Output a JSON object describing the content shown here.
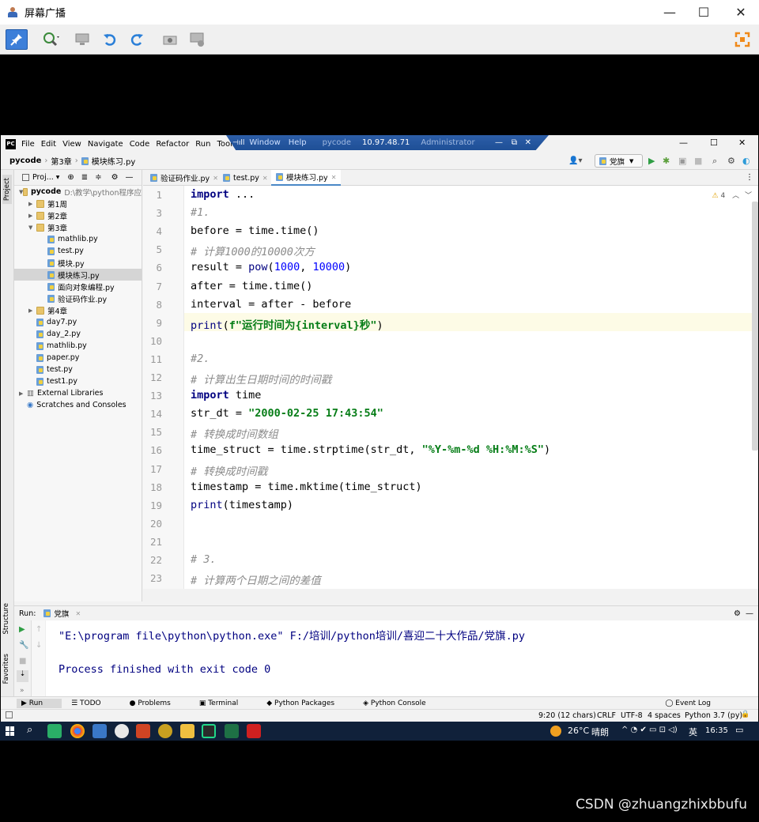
{
  "outer_window": {
    "title": "屏幕广播",
    "minimize": "—",
    "maximize": "☐",
    "close": "✕"
  },
  "ide": {
    "menu": [
      "File",
      "Edit",
      "View",
      "Navigate",
      "Code",
      "Refactor",
      "Run",
      "Tools"
    ],
    "remote_bar": {
      "items": [
        "Window",
        "Help"
      ],
      "host_label": "pycode",
      "ip": "10.97.48.71",
      "user": "Administrator"
    },
    "window_controls": {
      "minimize": "—",
      "maximize": "☐",
      "close": "✕"
    },
    "breadcrumb": [
      "pycode",
      "第3章",
      "模块练习.py"
    ],
    "run_config": "党旗",
    "project_panel": {
      "title": "Proj...",
      "root": {
        "name": "pycode",
        "path": "D:\\教学\\python程序应"
      },
      "items": [
        {
          "label": "第1周",
          "type": "folder",
          "level": 1,
          "expanded": false
        },
        {
          "label": "第2章",
          "type": "folder",
          "level": 1,
          "expanded": false
        },
        {
          "label": "第3章",
          "type": "folder",
          "level": 1,
          "expanded": true
        },
        {
          "label": "mathlib.py",
          "type": "py",
          "level": 2
        },
        {
          "label": "test.py",
          "type": "py",
          "level": 2
        },
        {
          "label": "模块.py",
          "type": "py",
          "level": 2
        },
        {
          "label": "模块练习.py",
          "type": "py",
          "level": 2,
          "selected": true
        },
        {
          "label": "面向对象编程.py",
          "type": "py",
          "level": 2
        },
        {
          "label": "验证码作业.py",
          "type": "py",
          "level": 2
        },
        {
          "label": "第4章",
          "type": "folder",
          "level": 1,
          "expanded": false
        },
        {
          "label": "day7.py",
          "type": "py",
          "level": 1
        },
        {
          "label": "day_2.py",
          "type": "py",
          "level": 1
        },
        {
          "label": "mathlib.py",
          "type": "py",
          "level": 1
        },
        {
          "label": "paper.py",
          "type": "py",
          "level": 1
        },
        {
          "label": "test.py",
          "type": "py",
          "level": 1
        },
        {
          "label": "test1.py",
          "type": "py",
          "level": 1
        }
      ],
      "external": "External Libraries",
      "scratches": "Scratches and Consoles"
    },
    "tabs": [
      {
        "label": "验证码作业.py",
        "active": false
      },
      {
        "label": "test.py",
        "active": false
      },
      {
        "label": "模块练习.py",
        "active": true
      }
    ],
    "warnings": "4",
    "code_lines": [
      {
        "n": "1",
        "text": "import ..."
      },
      {
        "n": "3",
        "text": "#1."
      },
      {
        "n": "4",
        "text": "before = time.time()"
      },
      {
        "n": "5",
        "text": "# 计算1000的10000次方"
      },
      {
        "n": "6",
        "text": "result = pow(1000, 10000)"
      },
      {
        "n": "7",
        "text": "after = time.time()"
      },
      {
        "n": "8",
        "text": "interval = after - before"
      },
      {
        "n": "9",
        "text": "print(f\"运行时间为{interval}秒\")"
      },
      {
        "n": "10",
        "text": ""
      },
      {
        "n": "11",
        "text": "#2."
      },
      {
        "n": "12",
        "text": "# 计算出生日期时间的时间戳"
      },
      {
        "n": "13",
        "text": "import time"
      },
      {
        "n": "14",
        "text": "str_dt = \"2000-02-25 17:43:54\""
      },
      {
        "n": "15",
        "text": "# 转换成时间数组"
      },
      {
        "n": "16",
        "text": "time_struct = time.strptime(str_dt, \"%Y-%m-%d %H:%M:%S\")"
      },
      {
        "n": "17",
        "text": "# 转换成时间戳"
      },
      {
        "n": "18",
        "text": "timestamp = time.mktime(time_struct)"
      },
      {
        "n": "19",
        "text": "print(timestamp)"
      },
      {
        "n": "20",
        "text": ""
      },
      {
        "n": "21",
        "text": ""
      },
      {
        "n": "22",
        "text": "# 3."
      },
      {
        "n": "23",
        "text": "# 计算两个日期之间的差值"
      }
    ],
    "run_panel": {
      "label": "Run:",
      "config": "党旗",
      "output_line1": "\"E:\\program file\\python\\python.exe\" F:/培训/python培训/喜迎二十大作品/党旗.py",
      "output_line2": "Process finished with exit code 0"
    },
    "side_labels": {
      "project": "Project",
      "structure": "Structure",
      "favorites": "Favorites"
    },
    "bottom_tabs": [
      "Run",
      "TODO",
      "Problems",
      "Terminal",
      "Python Packages",
      "Python Console"
    ],
    "event_log": "Event Log",
    "status": {
      "position": "9:20 (12 chars)",
      "line_sep": "CRLF",
      "encoding": "UTF-8",
      "indent": "4 spaces",
      "interpreter": "Python 3.7 (py)"
    }
  },
  "taskbar": {
    "weather_temp": "26°C",
    "weather_text": "晴朗",
    "ime": "英",
    "time": "16:35"
  },
  "watermark": "CSDN @zhuangzhixbbufu",
  "colors": {
    "keyword": "#000080",
    "string": "#067d17",
    "number": "#0000ff",
    "comment": "#8c8c8c",
    "taskbar": "#10213a",
    "remote_bar": "#1e4f96"
  }
}
